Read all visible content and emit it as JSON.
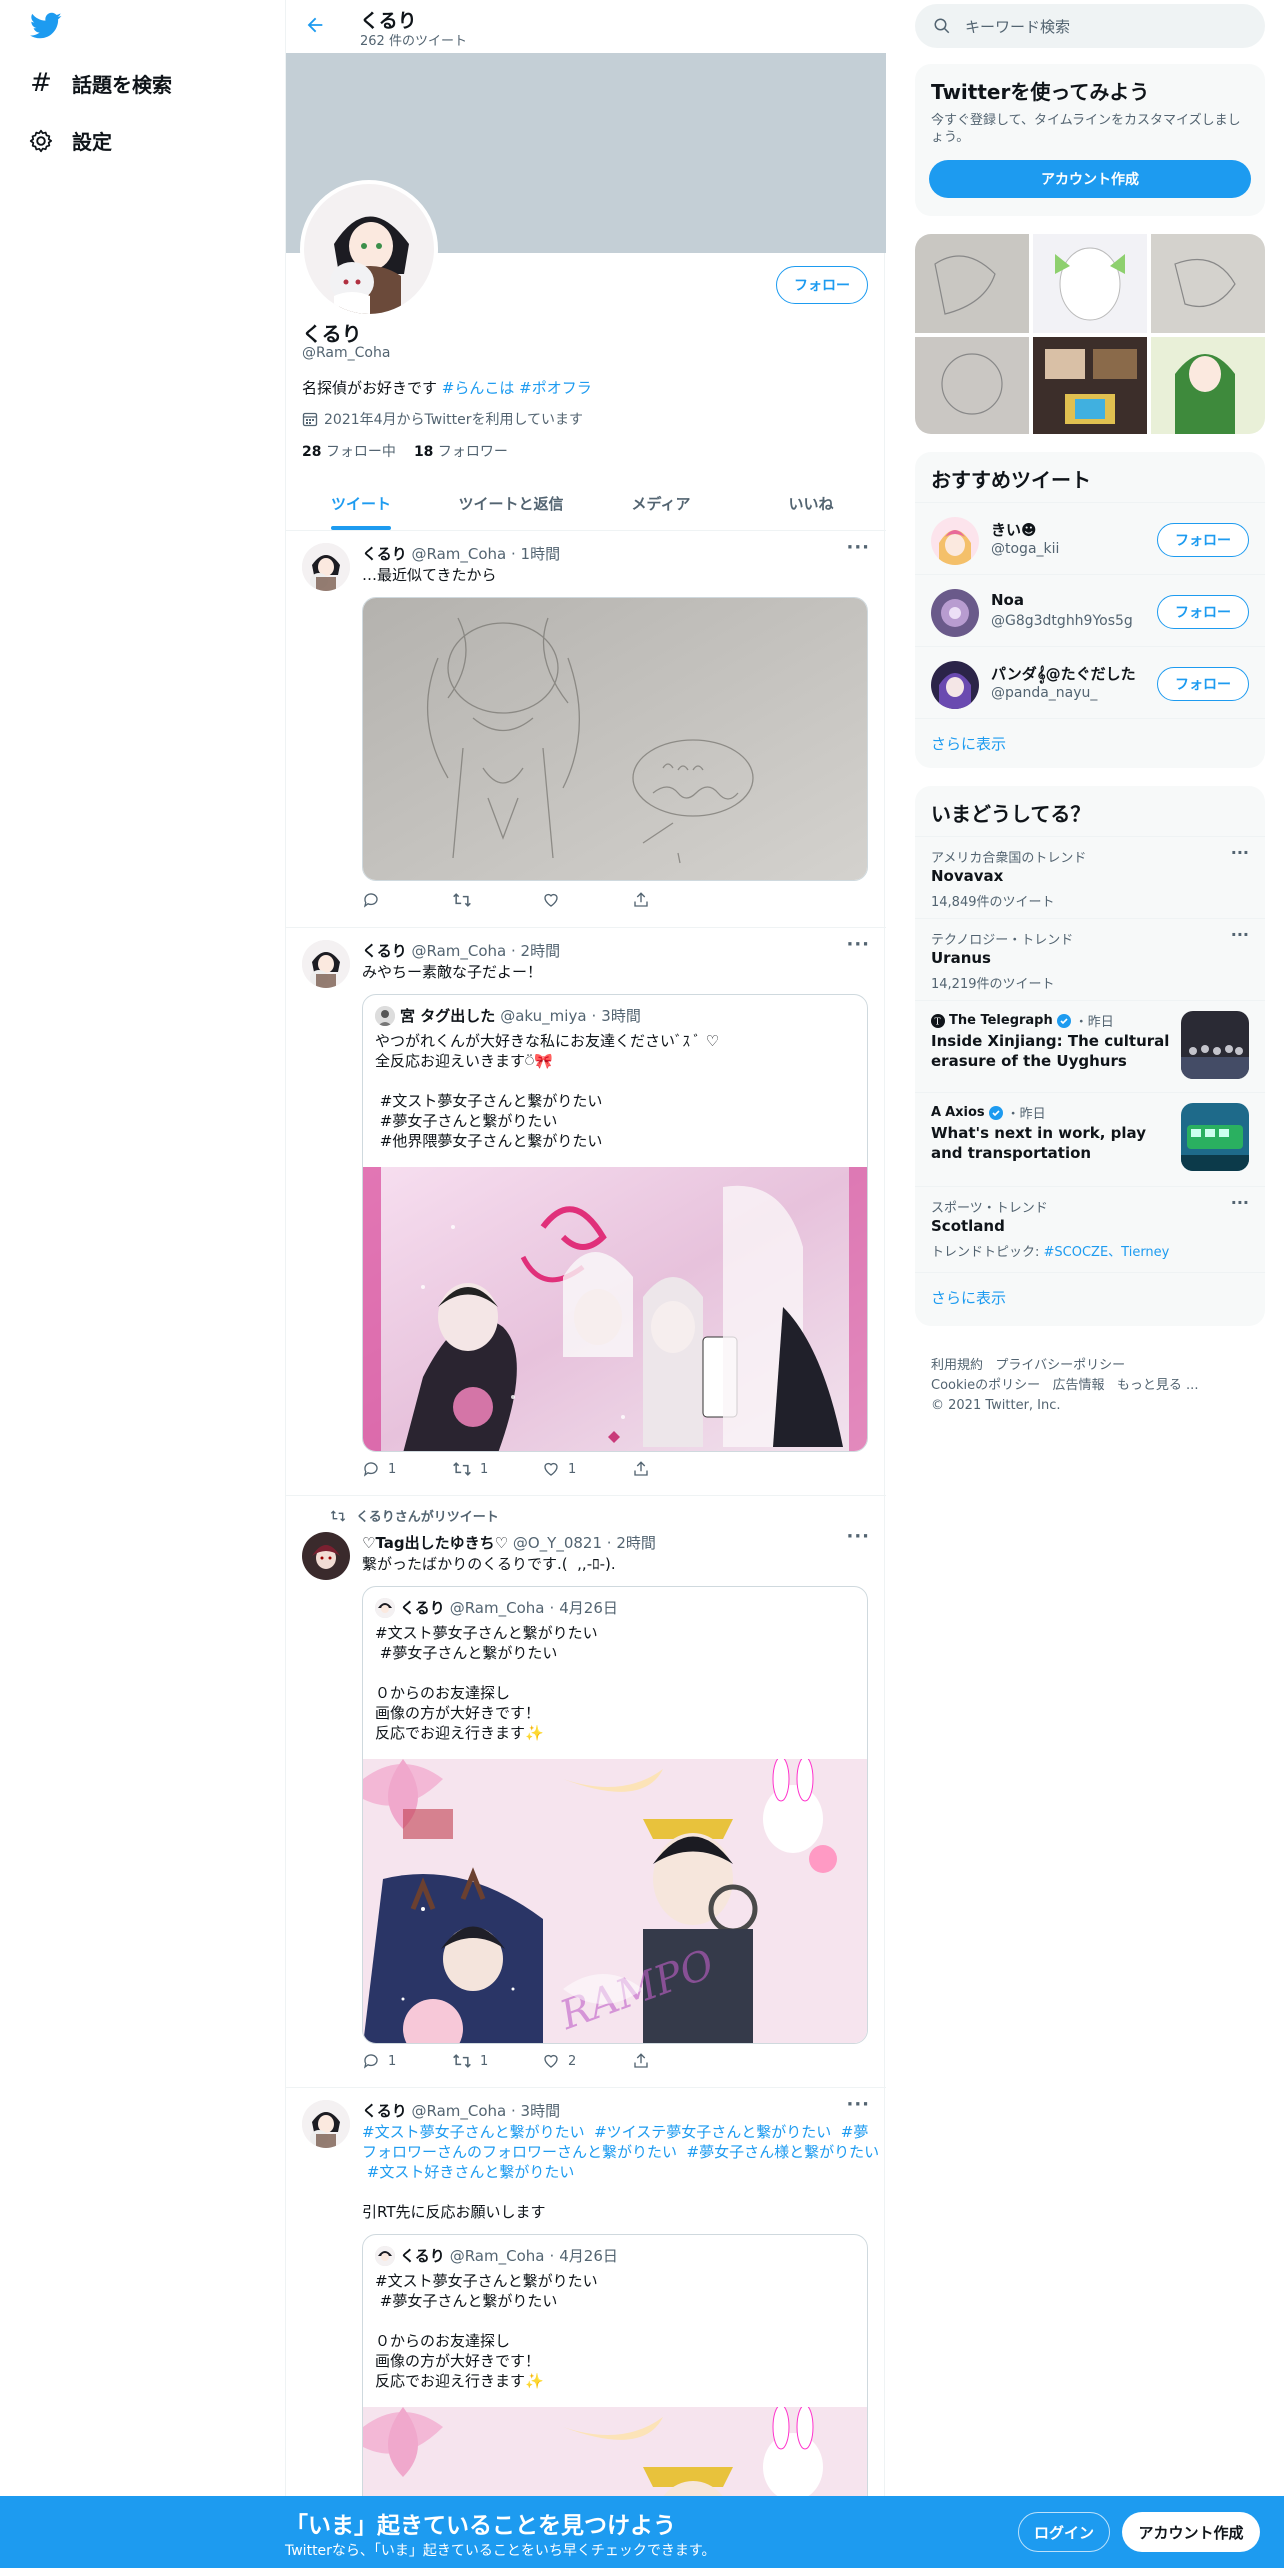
{
  "nav": {
    "search_label": "話題を検索",
    "settings_label": "設定"
  },
  "header": {
    "title": "くるり",
    "tweet_count": "262 件のツイート"
  },
  "profile": {
    "name": "くるり",
    "handle": "@Ram_Coha",
    "bio_text": "名探偵がお好きです ",
    "bio_tag1": "#らんこは",
    "bio_tag2": "#ポオフラ",
    "joined": "2021年4月からTwitterを利用しています",
    "following_count": "28",
    "following_label": "フォロー中",
    "followers_count": "18",
    "followers_label": "フォロワー",
    "follow_button": "フォロー"
  },
  "tabs": [
    "ツイート",
    "ツイートと返信",
    "メディア",
    "いいね"
  ],
  "tweets": [
    {
      "name": "くるり",
      "handle": "@Ram_Coha",
      "time": "1時間",
      "text": "…最近似てきたから"
    },
    {
      "name": "くるり",
      "handle": "@Ram_Coha",
      "time": "2時間",
      "text": "みやちー素敵な子だよー！",
      "quote": {
        "name": "宮 タグ出した",
        "handle": "@aku_miya",
        "time": "3時間",
        "text": "やつがれくんが大好きな私にお友達くださいﾞｽ ﾞ ♡\n全反応お迎えいきます⍥🎀\n\n #文スト夢女子さんと繋がりたい\n #夢女子さんと繋がりたい\n #他界隈夢女子さんと繋がりたい"
      },
      "actions": {
        "reply": "1",
        "retweet": "1",
        "like": "1"
      }
    },
    {
      "retweeted_by": "くるりさんがリツイート",
      "name": "♡Tag出したゆきち♡",
      "handle": "@O_Y_0821",
      "time": "2時間",
      "text": "繋がったばかりのくるりです.(  ,,-ﾛ-).",
      "quote": {
        "name": "くるり",
        "handle": "@Ram_Coha",
        "time": "4月26日",
        "text": "#文スト夢女子さんと繋がりたい\n #夢女子さんと繋がりたい\n\n０からのお友達探し\n画像の方が大好きです！\n反応でお迎え行きます✨"
      },
      "actions": {
        "reply": "1",
        "retweet": "1",
        "like": "2"
      }
    },
    {
      "name": "くるり",
      "handle": "@Ram_Coha",
      "time": "3時間",
      "tags_line1": "#文スト夢女子さんと繋がりたい  #ツイステ夢女子さんと繋がりたい  #夢",
      "tags_line2": "フォロワーさんのフォロワーさんと繋がりたい  #夢女子さん様と繋がりたい",
      "tags_line3": " #文スト好きさんと繋がりたい",
      "text": "引RT先に反応お願いします",
      "quote": {
        "name": "くるり",
        "handle": "@Ram_Coha",
        "time": "4月26日",
        "text": "#文スト夢女子さんと繋がりたい\n #夢女子さんと繋がりたい\n\n０からのお友達探し\n画像の方が大好きです！\n反応でお迎え行きます✨"
      }
    }
  ],
  "right": {
    "search_placeholder": "キーワード検索",
    "signup_card": {
      "title": "Twitterを使ってみよう",
      "subtitle": "今すぐ登録して、タイムラインをカスタマイズしましょう。",
      "button": "アカウント作成"
    },
    "recommend": {
      "title": "おすすめツイート",
      "users": [
        {
          "name": "きい☻",
          "handle": "@toga_kii"
        },
        {
          "name": "Noa",
          "handle": "@G8g3dtghh9Yos5g"
        },
        {
          "name": "パンダ𝄞@たぐだした",
          "handle": "@panda_nayu_"
        }
      ],
      "follow_label": "フォロー",
      "show_more": "さらに表示"
    },
    "trends": {
      "title": "いまどうしてる？",
      "items": [
        {
          "meta": "アメリカ合衆国のトレンド",
          "name": "Novavax",
          "count": "14,849件のツイート"
        },
        {
          "meta": "テクノロジー・トレンド",
          "name": "Uranus",
          "count": "14,219件のツイート"
        },
        {
          "meta": "The Telegraph",
          "time": "・昨日",
          "name": "Inside Xinjiang: The cultural erasure of the Uyghurs"
        },
        {
          "meta": "Axios",
          "time": "・昨日",
          "name": "What's next in work, play and transportation"
        },
        {
          "meta": "スポーツ・トレンド",
          "name": "Scotland",
          "count_prefix": "トレンドトピック: ",
          "count_links": "#SCOCZE、Tierney"
        }
      ],
      "show_more": "さらに表示"
    },
    "footer": {
      "line1": "利用規約   プライバシーポリシー",
      "line2": "Cookieのポリシー   広告情報   もっと見る ...",
      "line3": "© 2021 Twitter, Inc."
    }
  },
  "bottom": {
    "title": "「いま」起きていることを見つけよう",
    "subtitle": "Twitterなら、「いま」起きていることをいち早くチェックできます。",
    "login": "ログイン",
    "signup": "アカウント作成"
  },
  "colors": {
    "accent": "#1d9bf0",
    "text": "#0f1419",
    "muted": "#536471"
  }
}
